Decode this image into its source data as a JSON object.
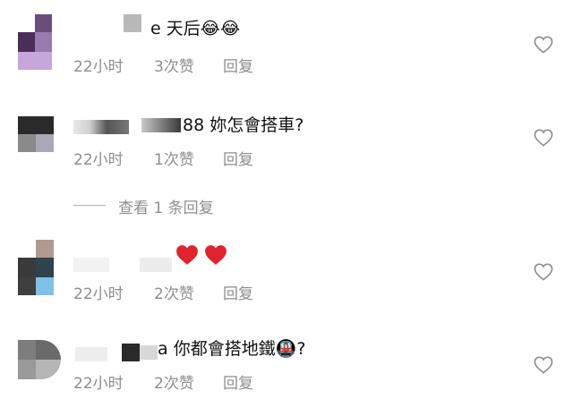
{
  "comments": [
    {
      "name_tail": "e",
      "text": "天后😂😂",
      "time": "22小时",
      "likes": "3次赞",
      "reply": "回复"
    },
    {
      "name_tail": "88",
      "text": "妳怎會搭車?",
      "time": "22小时",
      "likes": "1次赞",
      "reply": "回复"
    },
    {
      "name_tail": "",
      "text": "",
      "time": "22小时",
      "likes": "2次赞",
      "reply": "回复"
    },
    {
      "name_tail": "a",
      "text": "你都會搭地鐵🚇?",
      "time": "22小时",
      "likes": "2次赞",
      "reply": "回复"
    }
  ],
  "view_replies": "查看 1 条回复",
  "icons": {
    "like": "heart-outline-icon",
    "emoji_heart": "red-heart-emoji"
  },
  "colors": {
    "meta": "#8e8e8e",
    "heart_emoji": "#e0242f"
  }
}
